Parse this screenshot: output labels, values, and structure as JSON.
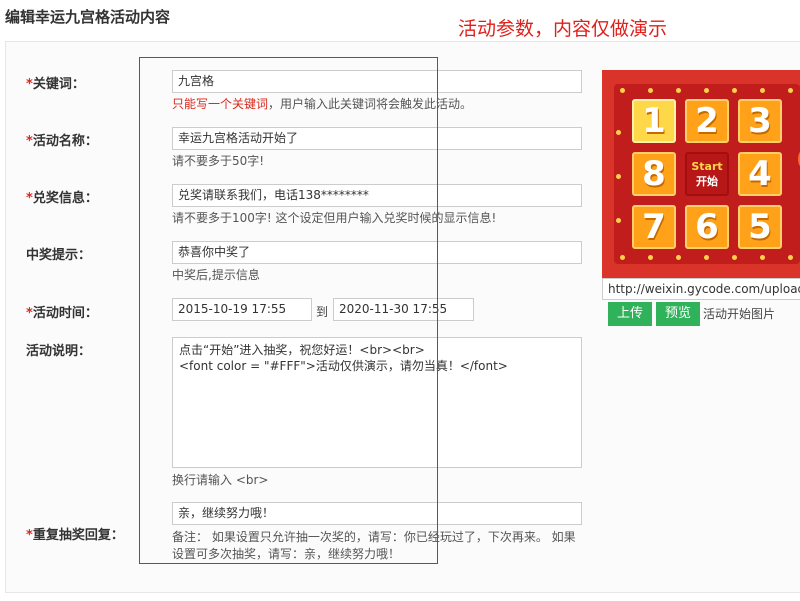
{
  "page": {
    "title": "编辑幸运九宫格活动内容",
    "demo_note": "活动参数，内容仅做演示"
  },
  "form": {
    "required_mark": "*",
    "keyword": {
      "label": "关键词：",
      "value": "九宫格",
      "hint_red": "只能写一个关键词",
      "hint_rest": "，用户输入此关键词将会触发此活动。"
    },
    "activity_name": {
      "label": "活动名称：",
      "value": "幸运九宫格活动开始了",
      "hint": "请不要多于50字!"
    },
    "prize_info": {
      "label": "兑奖信息：",
      "value": "兑奖请联系我们，电话138********",
      "hint": "请不要多于100字! 这个设定但用户输入兑奖时候的显示信息!"
    },
    "win_prompt": {
      "label": "中奖提示：",
      "value": "恭喜你中奖了",
      "hint": "中奖后,提示信息"
    },
    "activity_time": {
      "label": "活动时间：",
      "start": "2015-10-19 17:55",
      "separator": "到",
      "end": "2020-11-30 17:55"
    },
    "description": {
      "label": "活动说明：",
      "lines": [
        "点击“开始”进入抽奖，祝您好运！<br><br>",
        "<font color = \"#FFF\">活动仅供演示，请勿当真！</font>"
      ],
      "hint": "换行请输入 <br>"
    },
    "repeat_reply": {
      "label": "重复抽奖回复：",
      "value": "亲，继续努力哦！",
      "hint_line1": "备注： 如果设置只允许抽一次奖的，请写：你已经玩过了，下次再来。 如果",
      "hint_line2": "设置可多次抽奖，请写：亲，继续努力哦！"
    }
  },
  "image_panel": {
    "grid": [
      "1",
      "2",
      "3",
      "8",
      "",
      "4",
      "7",
      "6",
      "5"
    ],
    "center_top": "Start",
    "center_bottom": "开始",
    "url": "http://weixin.gycode.com/uploads/",
    "upload_label": "上传",
    "preview_label": "预览",
    "image_caption": "活动开始图片"
  },
  "colors": {
    "accent_red": "#e0201b",
    "button_green": "#2fb25a",
    "cell_orange": "#ffa21a",
    "cell_active": "#ffd84a"
  }
}
